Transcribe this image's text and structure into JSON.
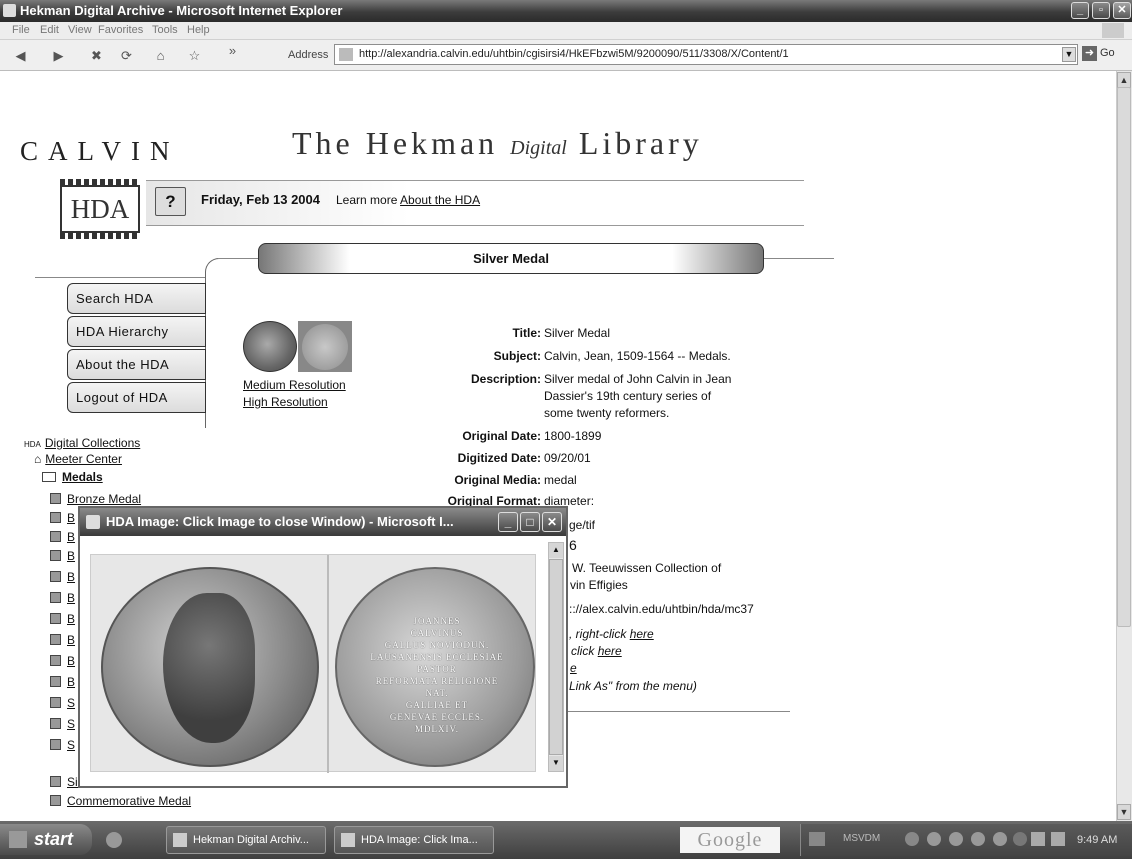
{
  "window": {
    "title": "Hekman Digital Archive - Microsoft Internet Explorer"
  },
  "menu": [
    "File",
    "Edit",
    "View",
    "Favorites",
    "Tools",
    "Help"
  ],
  "toolbar": {
    "address_label": "Address",
    "url": "http://alexandria.calvin.edu/uhtbin/cgisirsi4/HkEFbzwi5M/9200090/511/3308/X/Content/1",
    "go_label": "Go",
    "chevron": "»"
  },
  "header": {
    "calvin": "CALVIN",
    "library_pre": "The Hekman",
    "library_digital": "Digital",
    "library_post": "Library",
    "logo": "HDA"
  },
  "banner": {
    "help": "?",
    "date": "Friday, Feb 13 2004",
    "learn": "Learn more",
    "about_link": "About the HDA"
  },
  "page_title": "Silver Medal",
  "nav": [
    "Search HDA",
    "HDA Hierarchy",
    "About the HDA",
    "Logout of HDA"
  ],
  "links": {
    "medium": "Medium Resolution",
    "high": "High Resolution"
  },
  "metadata": [
    {
      "label": "Title:",
      "value": "Silver Medal"
    },
    {
      "label": "Subject:",
      "value": "Calvin, Jean, 1509-1564 -- Medals."
    },
    {
      "label": "Description:",
      "value": "Silver medal of John Calvin in Jean"
    },
    {
      "label": "",
      "value": "Dassier's 19th century series of"
    },
    {
      "label": "",
      "value": "some twenty reformers."
    },
    {
      "label": "Original Date:",
      "value": "1800-1899"
    },
    {
      "label": "Digitized Date:",
      "value": "09/20/01"
    },
    {
      "label": "Original Media:",
      "value": "medal"
    },
    {
      "label": "Original Format:",
      "value": "diameter:"
    }
  ],
  "partial_text": [
    "ge/tif",
    "6",
    "W. Teeuwissen Collection of",
    "vin Effigies",
    ":://alex.calvin.edu/uhtbin/hda/mc37",
    ", right-click",
    "here",
    "click",
    "here",
    "e",
    "Link As\" from the menu)"
  ],
  "tree": {
    "root": "Digital Collections",
    "center": "Meeter Center",
    "folder": "Medals",
    "items": [
      "Bronze Medal",
      "B",
      "B",
      "B",
      "B",
      "B",
      "B",
      "B",
      "B",
      "B",
      "S",
      "S",
      "S",
      "Silver Medal",
      "Silver Medal",
      "Commemorative Medal"
    ]
  },
  "popup": {
    "title": "HDA Image: Click Image to close Window) - Microsoft I...",
    "inscription": [
      "JOANNES",
      "CALVINUS",
      "GALLUS NOVIODUN.",
      "LAUSANENSIS ECCLESIAE",
      "PASTOR",
      "REFORMATA RELIGIONE",
      "NAT.",
      "GALLIAE ET",
      "GENEVAE ECCLES.",
      "MDLXIV."
    ]
  },
  "taskbar": {
    "start": "start",
    "tasks": [
      "Hekman Digital Archiv...",
      "HDA Image: Click Ima..."
    ],
    "search": "Google",
    "tray_label": "MSVDM",
    "clock": "9:49 AM"
  }
}
